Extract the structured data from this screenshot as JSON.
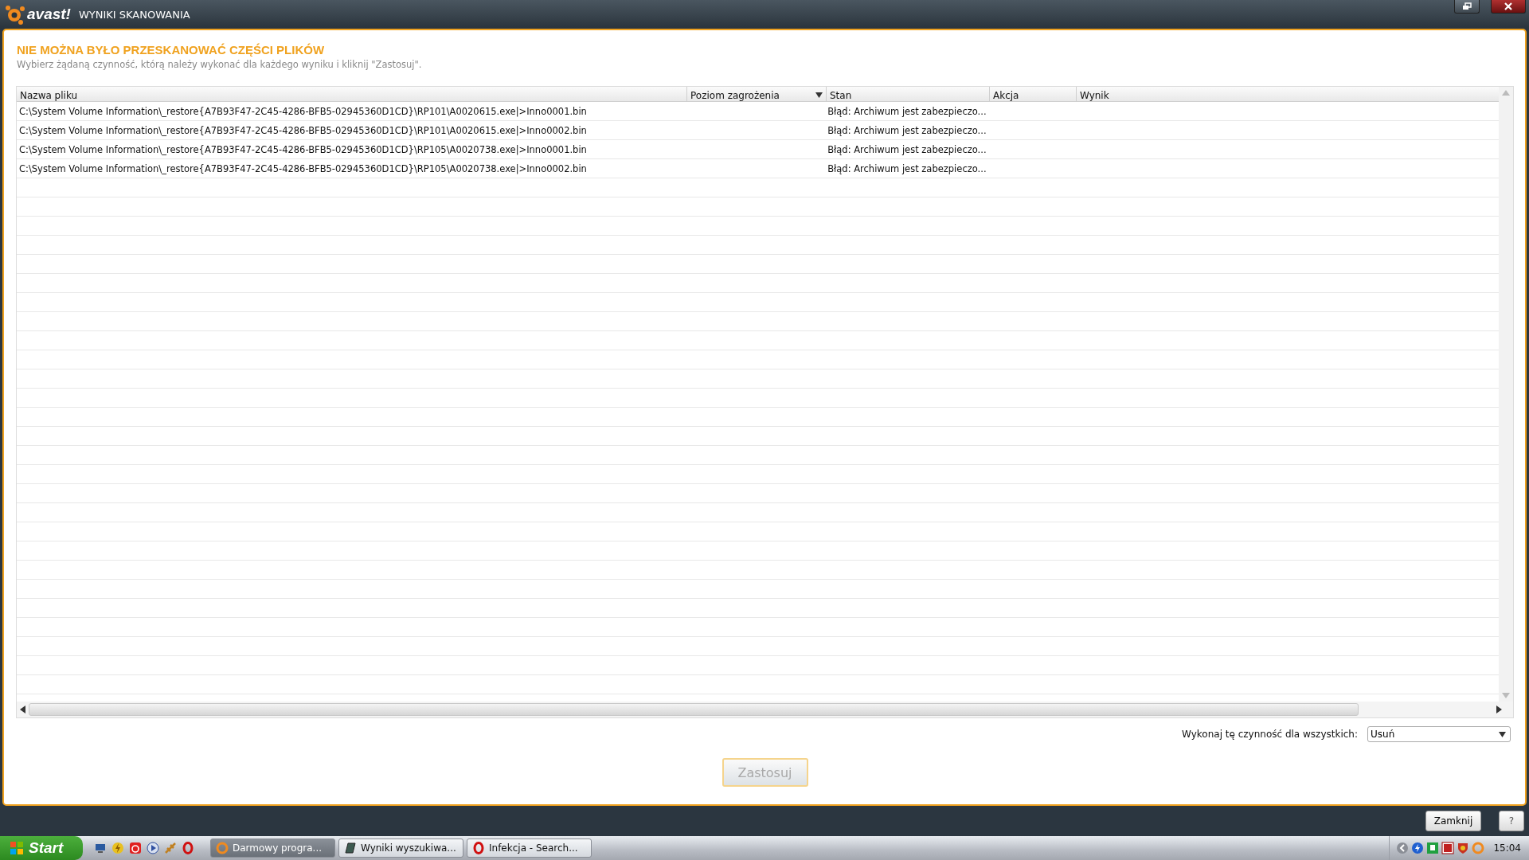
{
  "window": {
    "logo": "avast!",
    "title": "WYNIKI SKANOWANIA"
  },
  "heading": "NIE MOŻNA BYŁO PRZESKANOWAĆ CZĘŚCI PLIKÓW",
  "subtitle": "Wybierz żądaną czynność, którą należy wykonać dla każdego wyniku i kliknij \"Zastosuj\".",
  "table": {
    "columns": [
      {
        "label": "Nazwa pliku",
        "sorted": false
      },
      {
        "label": "Poziom zagrożenia",
        "sorted": true
      },
      {
        "label": "Stan",
        "sorted": false
      },
      {
        "label": "Akcja",
        "sorted": false
      },
      {
        "label": "Wynik",
        "sorted": false
      }
    ],
    "rows": [
      [
        "C:\\System Volume Information\\_restore{A7B93F47-2C45-4286-BFB5-02945360D1CD}\\RP101\\A0020615.exe|>Inno0001.bin",
        "",
        "Błąd: Archiwum jest zabezpieczo...",
        "",
        ""
      ],
      [
        "C:\\System Volume Information\\_restore{A7B93F47-2C45-4286-BFB5-02945360D1CD}\\RP101\\A0020615.exe|>Inno0002.bin",
        "",
        "Błąd: Archiwum jest zabezpieczo...",
        "",
        ""
      ],
      [
        "C:\\System Volume Information\\_restore{A7B93F47-2C45-4286-BFB5-02945360D1CD}\\RP105\\A0020738.exe|>Inno0001.bin",
        "",
        "Błąd: Archiwum jest zabezpieczo...",
        "",
        ""
      ],
      [
        "C:\\System Volume Information\\_restore{A7B93F47-2C45-4286-BFB5-02945360D1CD}\\RP105\\A0020738.exe|>Inno0002.bin",
        "",
        "Błąd: Archiwum jest zabezpieczo...",
        "",
        ""
      ]
    ]
  },
  "apply_all": {
    "label": "Wykonaj tę czynność dla wszystkich:",
    "value": "Usuń"
  },
  "apply_button": {
    "label": "Zastosuj",
    "disabled": true
  },
  "footer_buttons": [
    "Zamknij",
    "?"
  ],
  "taskbar": {
    "start": "Start",
    "tasks": [
      {
        "label": "Darmowy progra...",
        "selected": true
      },
      {
        "label": "Wyniki wyszukiwa...",
        "selected": false
      },
      {
        "label": "Infekcja - Search...",
        "selected": false
      }
    ],
    "clock": "15:04"
  }
}
